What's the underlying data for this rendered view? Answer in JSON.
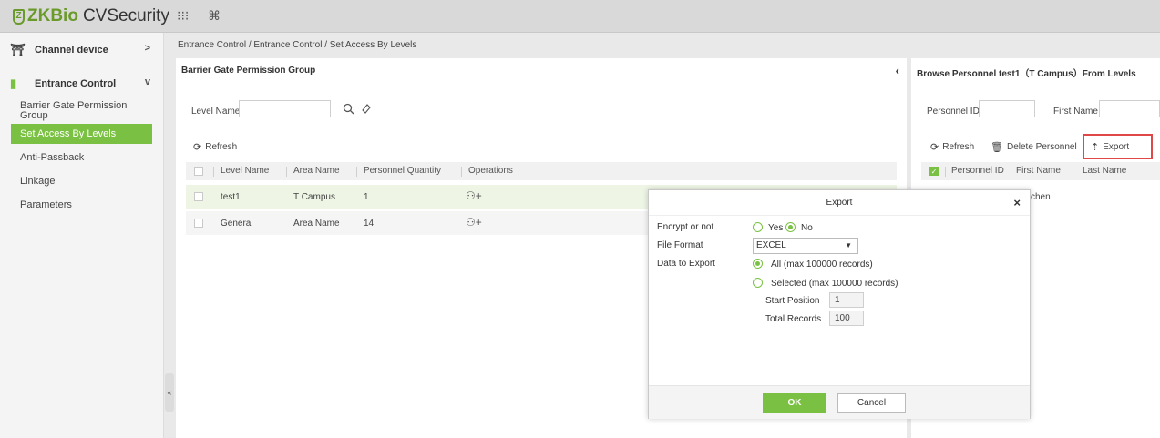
{
  "app": {
    "logo_zk": "ZKBio",
    "logo_rest": "CVSecurity",
    "brand_color": "#7ac143",
    "grid_icon": "⁝⁝⁝",
    "command_icon": "⌘"
  },
  "sidebar": {
    "groups": [
      {
        "label": "Channel device",
        "arrow": ">"
      },
      {
        "label": "Entrance Control",
        "arrow": "v"
      }
    ],
    "items": [
      {
        "label": "Barrier Gate Permission Group"
      },
      {
        "label": "Set Access By Levels",
        "active": true
      },
      {
        "label": "Anti-Passback"
      },
      {
        "label": "Linkage"
      },
      {
        "label": "Parameters"
      }
    ],
    "collapse": "«"
  },
  "breadcrumb": "Entrance Control / Entrance Control / Set Access By Levels",
  "left_panel": {
    "title": "Barrier Gate Permission Group",
    "collapse": "‹",
    "level_name_label": "Level Name",
    "refresh": "Refresh",
    "columns": [
      "Level Name",
      "Area Name",
      "Personnel Quantity",
      "Operations"
    ],
    "rows": [
      {
        "level": "test1",
        "area": "T Campus",
        "qty": "1"
      },
      {
        "level": "General",
        "area": "Area Name",
        "qty": "14"
      }
    ]
  },
  "right_panel": {
    "title": "Browse Personnel test1（T Campus）From Levels",
    "personnel_id_label": "Personnel ID",
    "first_name_label": "First Name",
    "refresh": "Refresh",
    "delete": "Delete Personnel",
    "export": "Export",
    "columns": [
      "Personnel ID",
      "First Name",
      "Last Name"
    ],
    "row_fragment": "chen"
  },
  "modal": {
    "title": "Export",
    "close": "×",
    "encrypt_label": "Encrypt or not",
    "yes": "Yes",
    "no": "No",
    "file_format_label": "File Format",
    "file_format_value": "EXCEL",
    "data_label": "Data to Export",
    "all_option": "All (max 100000 records)",
    "selected_option": "Selected (max 100000 records)",
    "start_label": "Start Position",
    "start_value": "1",
    "total_label": "Total Records",
    "total_value": "100",
    "ok": "OK",
    "cancel": "Cancel"
  }
}
